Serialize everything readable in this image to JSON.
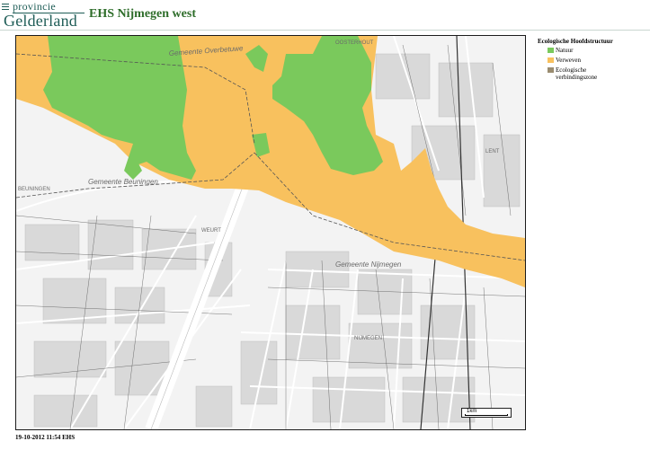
{
  "header": {
    "logo_top": "provincie",
    "logo_bottom": "Gelderland",
    "title": "EHS Nijmegen west"
  },
  "legend": {
    "title": "Ecologische Hoofdstructuur",
    "items": [
      {
        "label": "Natuur",
        "color": "#7ac95c"
      },
      {
        "label": "Verweven",
        "color": "#f8c15e"
      },
      {
        "label": "Ecologische verbindingszone",
        "color": "#9a8c70"
      }
    ]
  },
  "map": {
    "labels": {
      "overbetuwe": "Gemeente Overbetuwe",
      "beuningen": "Gemeente Beuningen",
      "nijmegen": "Gemeente Nijmegen",
      "oosterhout": "OOSTERHOUT",
      "lent": "LENT",
      "beuningen_town": "BEUNINGEN",
      "weurt": "WEURT",
      "nijmegen_town": "NIJMEGEN"
    },
    "colors": {
      "natuur": "#7ac95c",
      "verweven": "#f8c15e",
      "background": "#f3f3f3",
      "road": "#ffffff",
      "water": "#ffffff"
    },
    "scalebar_label": "1km"
  },
  "footer": {
    "text": "19-10-2012 11:54 EHS"
  }
}
